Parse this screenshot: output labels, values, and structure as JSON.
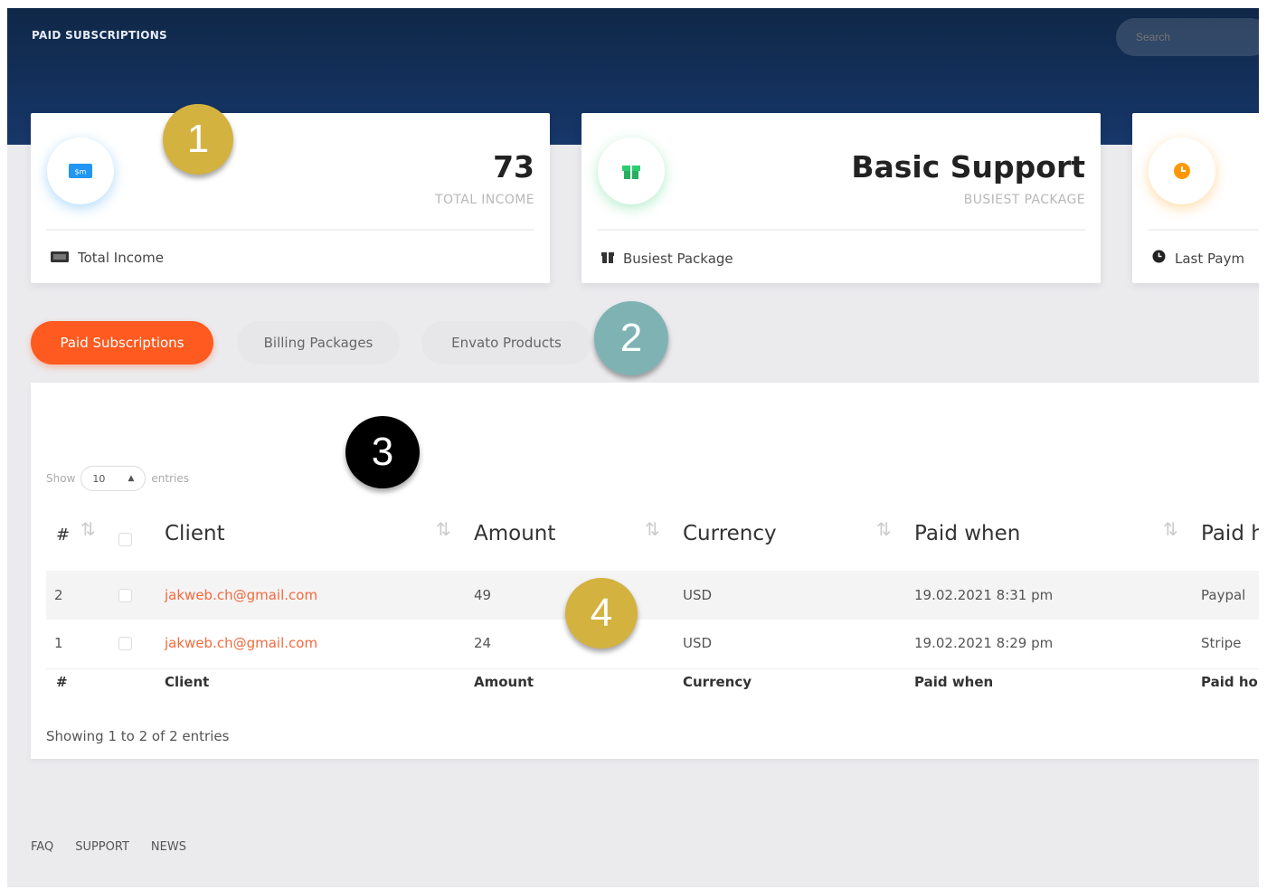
{
  "header": {
    "title": "PAID SUBSCRIPTIONS",
    "search_placeholder": "Search"
  },
  "cards": [
    {
      "value": "73",
      "sub": "TOTAL INCOME",
      "foot": "Total Income",
      "icon": "money-bill-icon",
      "accent": "#2196f3"
    },
    {
      "value": "Basic Support",
      "sub": "BUSIEST PACKAGE",
      "foot": "Busiest Package",
      "icon": "gift-icon",
      "accent": "#2ecc71"
    },
    {
      "value": "",
      "sub": "",
      "foot": "Last Paym",
      "icon": "clock-icon",
      "accent": "#ff9800"
    }
  ],
  "tabs": [
    "Paid Subscriptions",
    "Billing Packages",
    "Envato Products"
  ],
  "markers": [
    "1",
    "2",
    "3",
    "4"
  ],
  "table": {
    "show_label": "Show",
    "entries_value": "10",
    "entries_label": "entries",
    "headers": [
      "#",
      "Client",
      "Amount",
      "Currency",
      "Paid when",
      "Paid h"
    ],
    "rows": [
      {
        "num": "2",
        "client": "jakweb.ch@gmail.com",
        "amount": "49",
        "currency": "USD",
        "paid_when": "19.02.2021 8:31 pm",
        "paid_how": "Paypal"
      },
      {
        "num": "1",
        "client": "jakweb.ch@gmail.com",
        "amount": "24",
        "currency": "USD",
        "paid_when": "19.02.2021 8:29 pm",
        "paid_how": "Stripe"
      }
    ],
    "footer_headers": [
      "#",
      "Client",
      "Amount",
      "Currency",
      "Paid when",
      "Paid ho"
    ],
    "info": "Showing 1 to 2 of 2 entries"
  },
  "footer": {
    "links": [
      "FAQ",
      "SUPPORT",
      "NEWS"
    ]
  },
  "colors": {
    "header_dark": "#0f2747",
    "accent_orange": "#ff5a1f",
    "email_link": "#f26a3d",
    "marker_gold": "#d4b23f",
    "marker_teal": "#7fb3b3",
    "marker_black": "#000000"
  }
}
